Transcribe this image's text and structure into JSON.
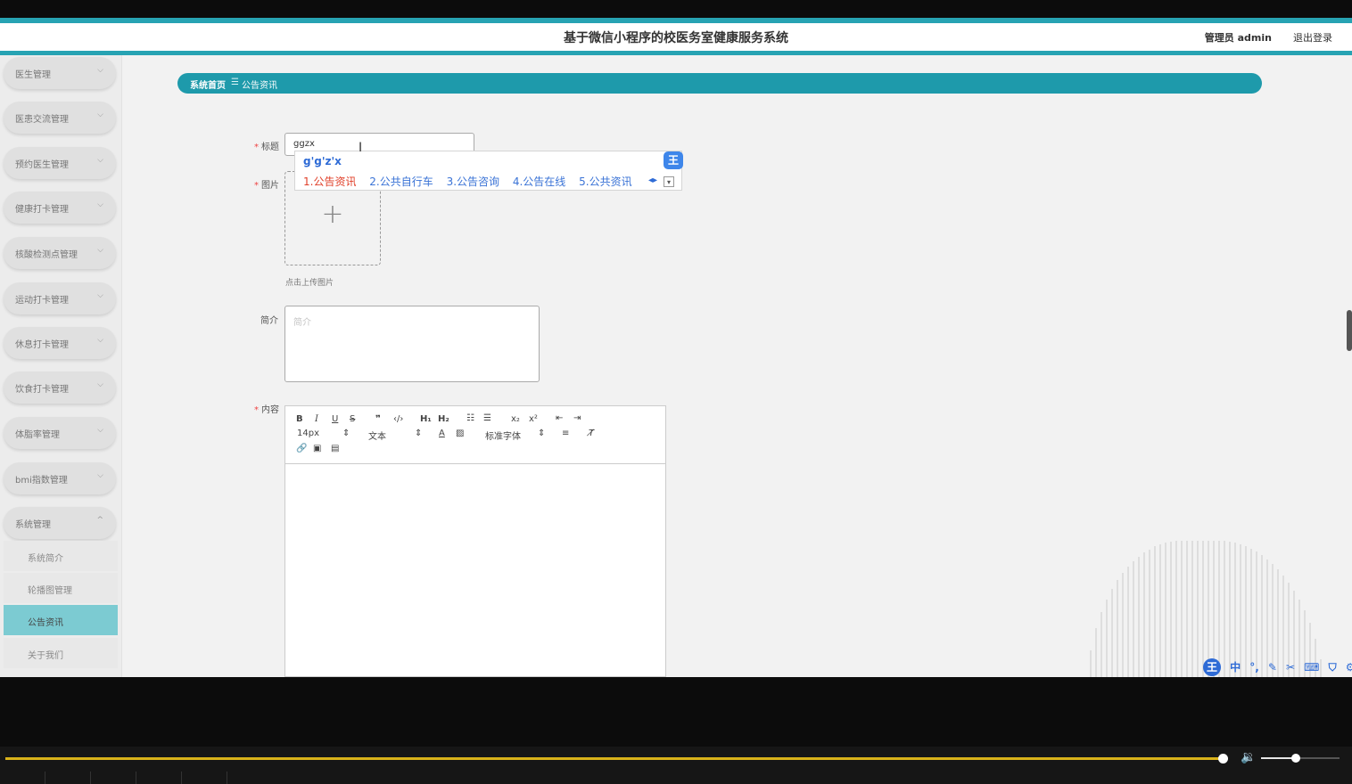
{
  "app": {
    "title": "基于微信小程序的校医务室健康服务系统",
    "user_label": "管理员 admin",
    "logout_label": "退出登录"
  },
  "sidebar": {
    "items": [
      {
        "label": "医生管理"
      },
      {
        "label": "医患交流管理"
      },
      {
        "label": "预约医生管理"
      },
      {
        "label": "健康打卡管理"
      },
      {
        "label": "核酸检测点管理"
      },
      {
        "label": "运动打卡管理"
      },
      {
        "label": "休息打卡管理"
      },
      {
        "label": "饮食打卡管理"
      },
      {
        "label": "体脂率管理"
      },
      {
        "label": "bmi指数管理"
      },
      {
        "label": "系统管理"
      }
    ],
    "submenu": [
      {
        "label": "系统简介"
      },
      {
        "label": "轮播图管理"
      },
      {
        "label": "公告资讯",
        "active": true
      },
      {
        "label": "关于我们"
      }
    ]
  },
  "breadcrumb": {
    "home": "系统首页",
    "separator": "☰",
    "current": "公告资讯"
  },
  "form": {
    "title_label": "标题",
    "title_value": "ggzx",
    "image_label": "图片",
    "upload_hint": "点击上传图片",
    "intro_label": "简介",
    "intro_placeholder": "简介",
    "content_label": "内容",
    "required_mark": "*"
  },
  "ime": {
    "pinyin": "g'g'z'x",
    "candidates": [
      "1.公告资讯",
      "2.公共自行车",
      "3.公告咨询",
      "4.公告在线",
      "5.公共资讯"
    ],
    "badge": "王"
  },
  "editor": {
    "font_size": "14px",
    "text_style": "文本",
    "font_family": "标准字体"
  },
  "colors": {
    "accent": "#27a3b3",
    "active_menu": "#7ccbd2",
    "breadcrumb": "#1e9aab",
    "seek": "#d9b21a"
  }
}
